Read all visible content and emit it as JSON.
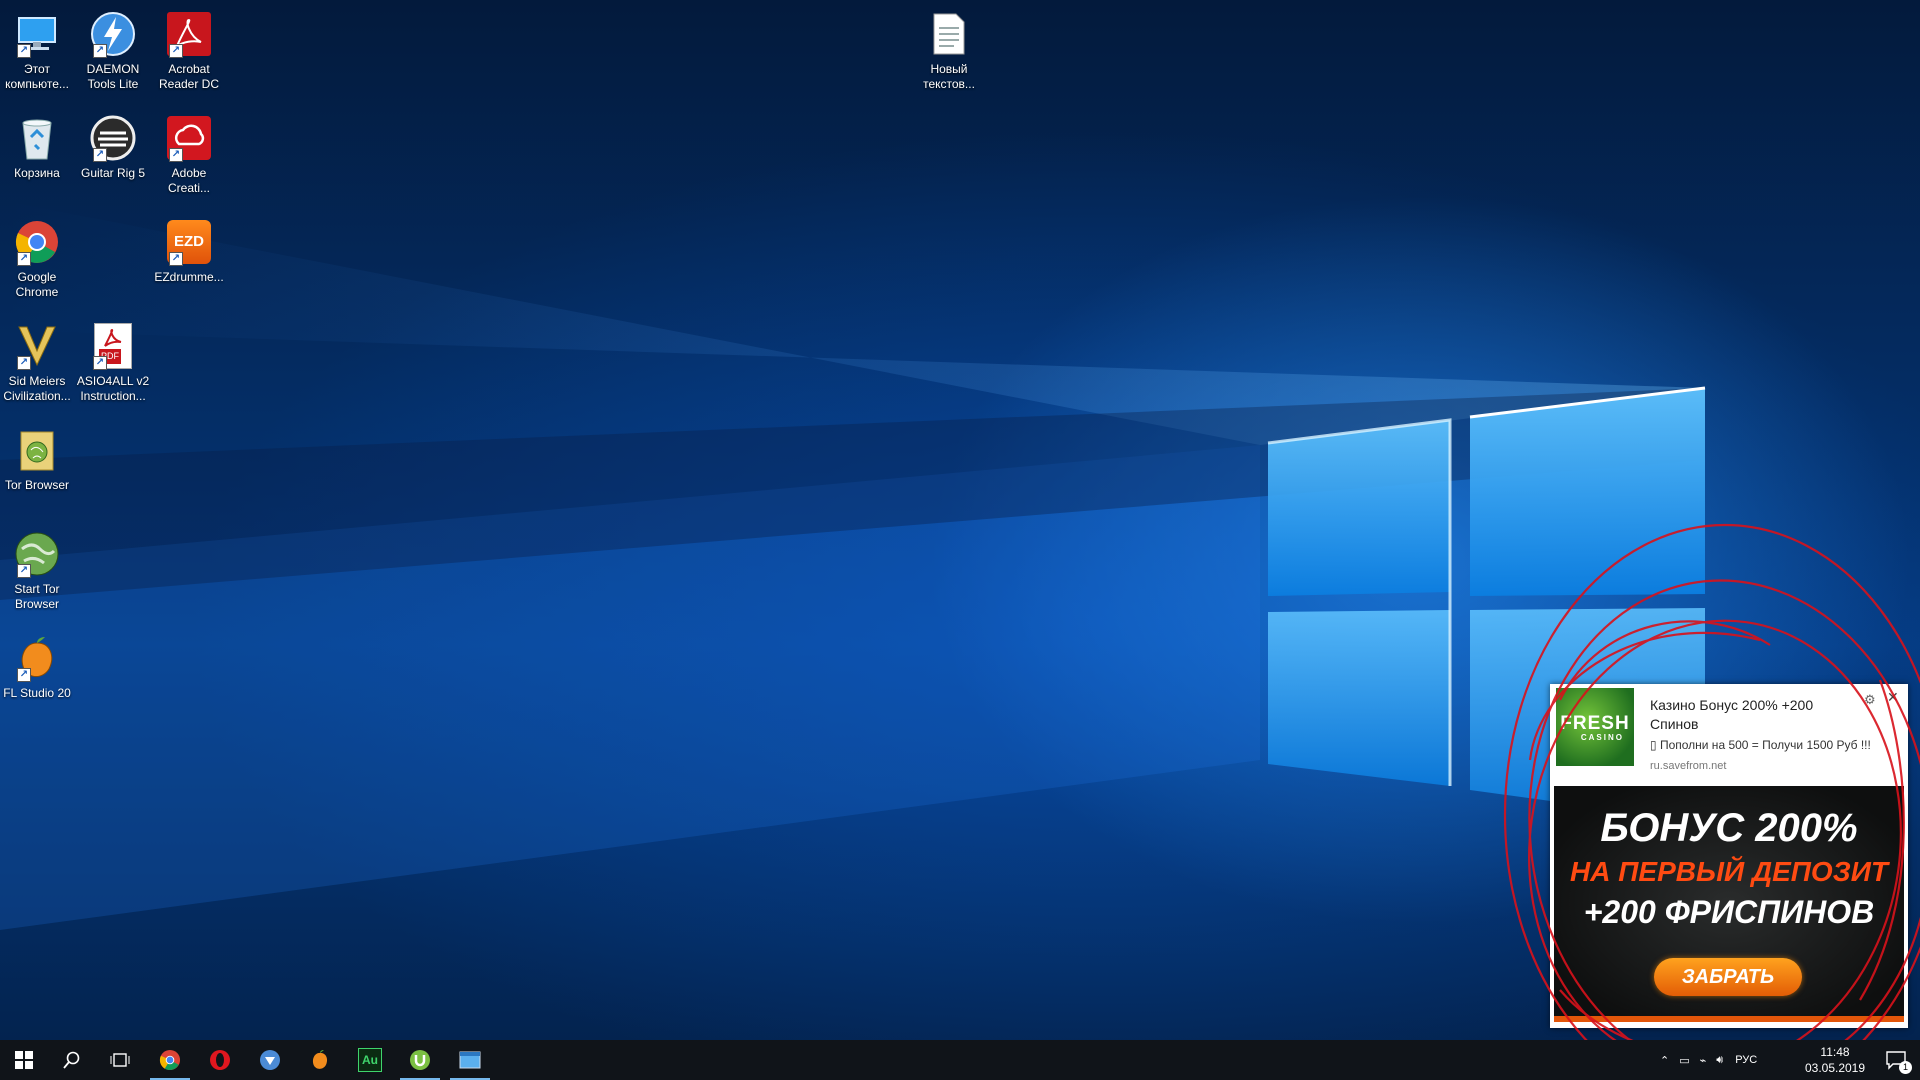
{
  "desktop": {
    "icons": [
      {
        "label": "Этот компьюте...",
        "icon": "this-pc-icon"
      },
      {
        "label": "DAEMON Tools Lite",
        "icon": "daemon-tools-icon"
      },
      {
        "label": "Acrobat Reader DC",
        "icon": "acrobat-reader-icon"
      },
      {
        "label": "Новый текстов...",
        "icon": "text-document-icon"
      },
      {
        "label": "Корзина",
        "icon": "recycle-bin-icon"
      },
      {
        "label": "Guitar Rig 5",
        "icon": "guitar-rig-icon"
      },
      {
        "label": "Adobe Creati...",
        "icon": "adobe-creative-cloud-icon"
      },
      {
        "label": "Google Chrome",
        "icon": "chrome-icon"
      },
      {
        "label": "EZdrumme...",
        "icon": "ezdrummer-icon"
      },
      {
        "label": "Sid Meiers Civilization...",
        "icon": "civilization-icon"
      },
      {
        "label": "ASIO4ALL v2 Instruction...",
        "icon": "pdf-icon"
      },
      {
        "label": "Tor Browser",
        "icon": "tor-browser-folder-icon"
      },
      {
        "label": "Start Tor Browser",
        "icon": "tor-globe-icon"
      },
      {
        "label": "FL Studio 20",
        "icon": "fl-studio-icon"
      }
    ],
    "ezd_text": "EZD",
    "pdf_text": "PDF"
  },
  "notification": {
    "logo_text": "FRESH",
    "logo_sub": "CASINO",
    "title": "Казино Бонус 200% +200 Спинов",
    "body": "▯ Пополни на 500 = Получи 1500 Руб !!!",
    "source": "ru.savefrom.net",
    "banner": {
      "line1": "БОНУС 200%",
      "line2": "НА ПЕРВЫЙ ДЕПОЗИТ",
      "line3": "+200 ФРИСПИНОВ",
      "button": "ЗАБРАТЬ"
    },
    "colors": {
      "accent": "#ff4b12",
      "button": "#f08a12"
    }
  },
  "taskbar": {
    "pinned": [
      "start-icon",
      "search-icon",
      "task-view-icon",
      "chrome-icon",
      "opera-icon",
      "tor-vpn-icon",
      "fl-studio-icon",
      "audition-icon",
      "utorrent-icon",
      "explorer-window-icon"
    ],
    "audition_text": "Au",
    "language": "РУС",
    "time": "11:48",
    "date": "03.05.2019",
    "notification_count": "1"
  }
}
